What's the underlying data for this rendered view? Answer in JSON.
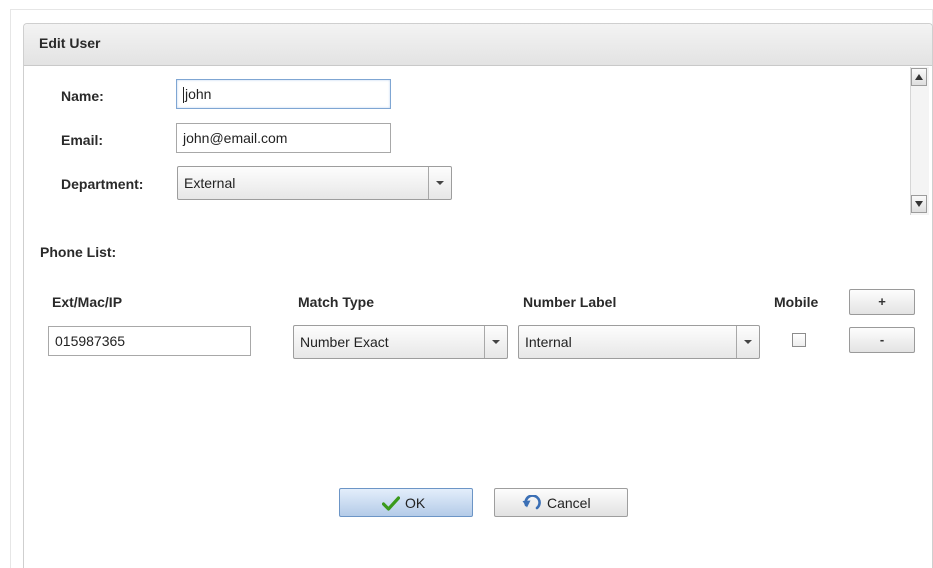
{
  "dialog": {
    "title": "Edit User"
  },
  "form": {
    "name_label": "Name:",
    "name_value": "john",
    "email_label": "Email:",
    "email_value": "john@email.com",
    "department_label": "Department:",
    "department_value": "External"
  },
  "phone_list": {
    "label": "Phone List:",
    "headers": {
      "ext": "Ext/Mac/IP",
      "match_type": "Match Type",
      "number_label": "Number Label",
      "mobile": "Mobile"
    },
    "rows": [
      {
        "ext": "015987365",
        "match_type": "Number Exact",
        "number_label": "Internal",
        "mobile": false
      }
    ],
    "add_label": "+",
    "remove_label": "-"
  },
  "buttons": {
    "ok_label": "OK",
    "cancel_label": "Cancel"
  },
  "icons": {
    "ok": "checkmark-icon",
    "cancel": "undo-icon",
    "dropdown": "chevron-down-icon"
  },
  "colors": {
    "ok_check": "#3a9a1c",
    "cancel_arrow": "#3b6fb5",
    "focus_border": "#7fa6d3"
  }
}
